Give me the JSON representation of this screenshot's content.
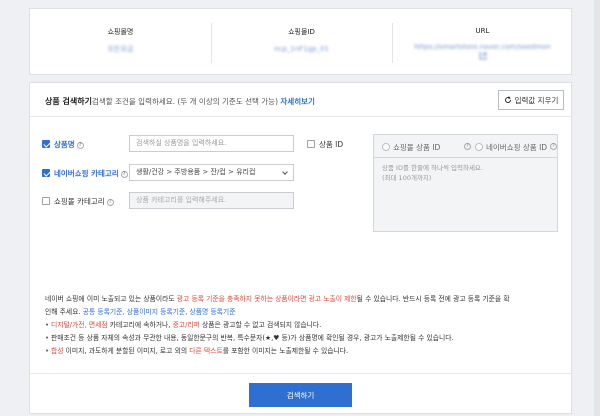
{
  "store_info": {
    "columns": [
      {
        "header": "쇼핑몰명",
        "value": "모든요금"
      },
      {
        "header": "쇼핑몰ID",
        "value": "ncp_1nF1gp_01"
      },
      {
        "header": "URL",
        "value": "https://smartstore.naver.com/seedmon"
      }
    ],
    "link_icon": "external-link-icon"
  },
  "search": {
    "title": "상품 검색하기",
    "description": "검색할 조건을 입력하세요. (두 개 이상의 기준도 선택 가능)",
    "detail_link": "자세히보기",
    "reset_label": "입력값 지우기",
    "product_name": {
      "label": "상품명",
      "checked": true,
      "placeholder": "검색하실 상품명을 입력하세요."
    },
    "product_id": {
      "label": "상품 ID",
      "checked": false
    },
    "naver_category": {
      "label": "네이버쇼핑 카테고리",
      "checked": true,
      "value": "생활/건강 > 주방용품 > 잔/컵 > 유리컵"
    },
    "mall_category": {
      "label": "쇼핑몰 카테고리",
      "checked": false,
      "placeholder": "상품 카테고리를 입력해주세요."
    },
    "id_options": {
      "opt1": "쇼핑몰 상품 ID",
      "opt2": "네이버쇼핑 상품 ID"
    },
    "id_placeholder_line1": "상품 ID를 한줄에 하나씩 입력하세요.",
    "id_placeholder_line2": "(최대 100개까지)",
    "notice": {
      "l1a": "네이버 쇼핑에 이미 노출되고 있는 상품이라도 ",
      "l1b": "광고 등록 기준을 충족하지 못하는 상품이라면 광고 노출이 제한",
      "l1c": "될 수 있습니다. 반드시 등록 전에 광고 등록 기준을 확",
      "l2a": "인해 주세요. ",
      "l2b": "공통 등록기준, 상품이미지 등록기준, 상품명 등록기준",
      "l3a": "디지털/가전, 면세점",
      "l3b": " 카테고리에 속하거나, ",
      "l3c": "중고/리퍼",
      "l3d": " 상품은 광고할 수 없고 검색되지 않습니다.",
      "l4": "판매조건 등 상품 자체의 속성과 무관한 내용, 동일한문구의 반복, 특수문자(★,♥ 등)가 상품명에 확인될 경우, 광고가 노출제한될 수 있습니다.",
      "l5a": "합성",
      "l5b": " 이미지, 과도하게 분할된 이미지, 로고 외의 ",
      "l5c": "다른 텍스트",
      "l5d": "를 포함한 이미지는 노출제한될 수 있습니다."
    },
    "submit_label": "검색하기"
  },
  "colors": {
    "accent": "#2f6fd1",
    "warning": "#e04a3a"
  }
}
